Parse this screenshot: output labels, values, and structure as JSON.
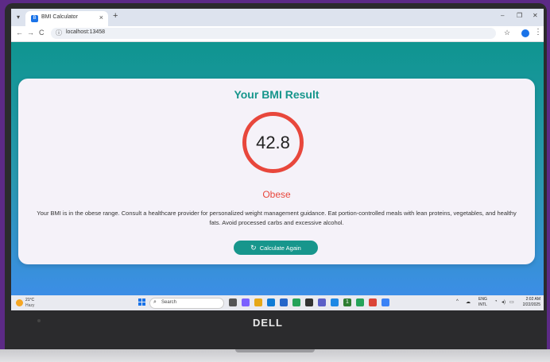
{
  "browser": {
    "tab_title": "BMI Calculator",
    "tab_close": "×",
    "new_tab": "+",
    "win_min": "–",
    "win_restore": "❐",
    "win_close": "✕",
    "back": "←",
    "forward": "→",
    "reload": "C",
    "url": "localhost:13458",
    "bookmark_icon": "☆",
    "menu_icon": "⋮"
  },
  "result": {
    "heading": "Your BMI Result",
    "bmi_value": "42.8",
    "category": "Obese",
    "description": "Your BMI is in the obese range. Consult a healthcare provider for personalized weight management guidance. Eat portion-controlled meals with lean proteins, vegetables, and healthy fats. Avoid processed carbs and excessive alcohol.",
    "button_label": "Calculate Again",
    "accent_color": "#17968c",
    "category_color": "#e8473c"
  },
  "taskbar": {
    "weather_temp": "21°C",
    "weather_desc": "Hazy",
    "search_placeholder": "Search",
    "lang_1": "ENG",
    "lang_2": "INTL",
    "time": "2:02 AM",
    "date": "2/22/2025",
    "notification_badge": "1"
  },
  "device": {
    "brand": "DELL"
  }
}
